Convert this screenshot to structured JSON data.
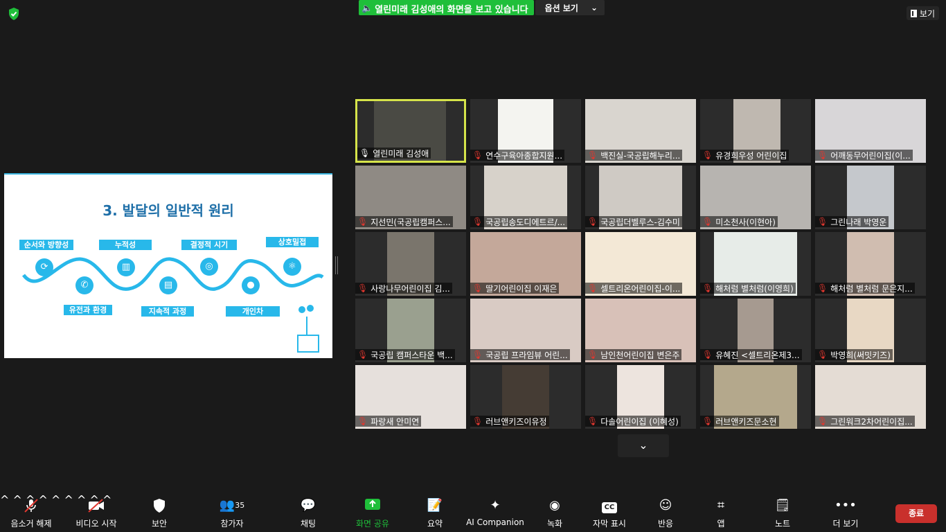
{
  "colors": {
    "accent_green": "#1fbf3a",
    "end_red": "#c9302c",
    "muted_red": "#e0372f",
    "slide_blue": "#28b8ea"
  },
  "top": {
    "share_message": "열린미래 김성애의 화면을 보고 있습니다",
    "options_label": "옵션 보기",
    "view_label": "보기"
  },
  "slide": {
    "title": "3. 발달의 일반적 원리",
    "labels": [
      "순서와 방향성",
      "누적성",
      "결정적 시기",
      "상호밀접",
      "유전과 환경",
      "지속적 과정",
      "개인차"
    ]
  },
  "participants": [
    {
      "name": "열린미래 김성애",
      "active": true
    },
    {
      "name": "연수구육아종합지원..."
    },
    {
      "name": "백진실-국공립해누리..."
    },
    {
      "name": "유경희우성 어린이집"
    },
    {
      "name": "어깨동무어린이집(이..."
    },
    {
      "name": "지선민(국공립캠퍼스..."
    },
    {
      "name": "국공립송도디에트르/..."
    },
    {
      "name": "국공립더벨루스-김수미"
    },
    {
      "name": "미소천사(이현아)"
    },
    {
      "name": "그린나래 박영운"
    },
    {
      "name": "사랑나무어린이집 김..."
    },
    {
      "name": "딸기어린이집 이재은"
    },
    {
      "name": "셀트리온어린이집-이..."
    },
    {
      "name": "해처럼 별처럼(이영희)"
    },
    {
      "name": "해처럼 별처럼 문은지..."
    },
    {
      "name": "국공립 캠퍼스타운 백..."
    },
    {
      "name": "국공립 프라임뷰 어린..."
    },
    {
      "name": "남인천어린이집 변은주"
    },
    {
      "name": "유혜진 <셀트리온제3..."
    },
    {
      "name": "박영희(써밋키즈)"
    },
    {
      "name": "파랑새 안미연"
    },
    {
      "name": "러브앤키즈이유정"
    },
    {
      "name": "다솔어린이집 (이혜성)"
    },
    {
      "name": "러브앤키즈문소현"
    },
    {
      "name": "그린워크2차어린이집..."
    }
  ],
  "toolbar": {
    "mute": "음소거 해제",
    "video": "비디오 시작",
    "security": "보안",
    "participants": "참가자",
    "participants_count": "35",
    "chat": "채팅",
    "share": "화면 공유",
    "summary": "요약",
    "ai": "AI Companion",
    "record": "녹화",
    "captions": "자막 표시",
    "captions_badge": "CC",
    "reactions": "반응",
    "apps": "앱",
    "notes": "노트",
    "more": "더 보기",
    "end": "종료"
  }
}
